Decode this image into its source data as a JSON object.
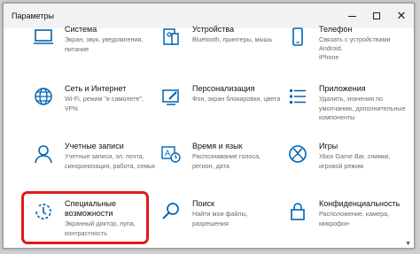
{
  "window": {
    "title": "Параметры",
    "minimize": "—",
    "maximize": "□",
    "close": "✕"
  },
  "tiles": [
    {
      "title": "Система",
      "desc": [
        "Экран, звук, уведомления,",
        "питание"
      ],
      "icon": "laptop-icon"
    },
    {
      "title": "Устройства",
      "desc": [
        "Bluetooth, принтеры, мышь"
      ],
      "icon": "devices-icon"
    },
    {
      "title": "Телефон",
      "desc": [
        "Связать с устройствами Android,",
        "iPhone"
      ],
      "icon": "phone-icon"
    },
    {
      "title": "Сеть и Интернет",
      "desc": [
        "Wi-Fi, режим \"в самолете\",",
        "VPN"
      ],
      "icon": "globe-icon"
    },
    {
      "title": "Персонализация",
      "desc": [
        "Фон, экран блокировки, цвета"
      ],
      "icon": "personalization-icon"
    },
    {
      "title": "Приложения",
      "desc": [
        "Удалить, значения по",
        "умолчанию, дополнительные",
        "компоненты"
      ],
      "icon": "apps-icon"
    },
    {
      "title": "Учетные записи",
      "desc": [
        "Учетные записи, эл. почта,",
        "синхронизация, работа, семья"
      ],
      "icon": "user-icon"
    },
    {
      "title": "Время и язык",
      "desc": [
        "Распознавание голоса,",
        "регион, дата"
      ],
      "icon": "time-language-icon"
    },
    {
      "title": "Игры",
      "desc": [
        "Xbox Game Bar, снимки,",
        "игровой режим"
      ],
      "icon": "xbox-icon"
    },
    {
      "title": "Специальные",
      "title2": "возможности",
      "desc": [
        "Экранный диктор, лупа,",
        "контрастность"
      ],
      "icon": "accessibility-icon"
    },
    {
      "title": "Поиск",
      "desc": [
        "Найти мои файлы,",
        "разрешения"
      ],
      "icon": "search-icon"
    },
    {
      "title": "Конфиденциальность",
      "desc": [
        "Расположение, камера,",
        "микрофон"
      ],
      "icon": "lock-icon"
    }
  ],
  "accent_color": "#0063b1",
  "highlight_color": "#e11a1a"
}
